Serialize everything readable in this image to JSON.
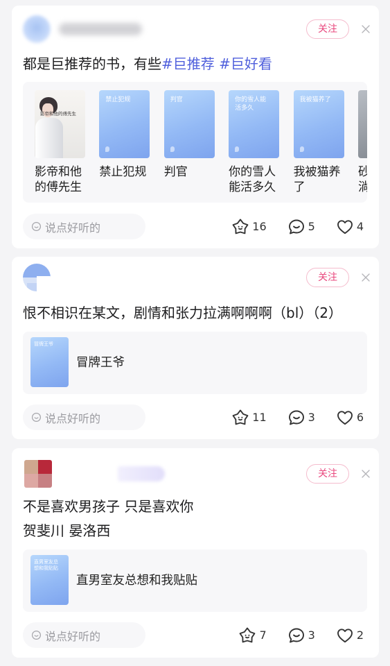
{
  "colors": {
    "page_bg": "#f4f4f6",
    "hashtag": "#4f5fdc",
    "follow": "#e9487e",
    "text_main": "#1c1c1e",
    "text_muted": "#9b9ba0"
  },
  "icons": {
    "reaction": "star-face-icon",
    "comment": "comment-bubble-icon",
    "like": "heart-icon",
    "close": "close-icon",
    "comment_input": "smiley-bubble-icon"
  },
  "posts": [
    {
      "follow_label": "关注",
      "text": "都是巨推荐的书，有些",
      "hashtags": "#巨推荐 #巨好看",
      "books": [
        {
          "cover_text": "影帝和他的傅先生",
          "title": "影帝和他的傅先生"
        },
        {
          "cover_text": "禁止犯规",
          "title": "禁止犯规"
        },
        {
          "cover_text": "判官",
          "title": "判官"
        },
        {
          "cover_text": "你的雪人能活多久",
          "title": "你的雪人能活多久"
        },
        {
          "cover_text": "我被猫养了",
          "title": "我被猫养了"
        },
        {
          "title": "砂\n淌"
        }
      ],
      "comment_placeholder": "说点好听的",
      "reaction_count": "16",
      "comment_count": "5",
      "like_count": "4"
    },
    {
      "follow_label": "关注",
      "text": "恨不相识在某文，剧情和张力拉满啊啊啊（bl）（2）",
      "books": [
        {
          "cover_text": "冒牌王爷",
          "title": "冒牌王爷"
        }
      ],
      "comment_placeholder": "说点好听的",
      "reaction_count": "11",
      "comment_count": "3",
      "like_count": "6"
    },
    {
      "follow_label": "关注",
      "text": "不是喜欢男孩子 只是喜欢你\n贺斐川 晏洛西",
      "books": [
        {
          "cover_text": "直男室友总想和我贴贴",
          "title": "直男室友总想和我贴贴"
        }
      ],
      "comment_placeholder": "说点好听的",
      "reaction_count": "7",
      "comment_count": "3",
      "like_count": "2"
    }
  ]
}
